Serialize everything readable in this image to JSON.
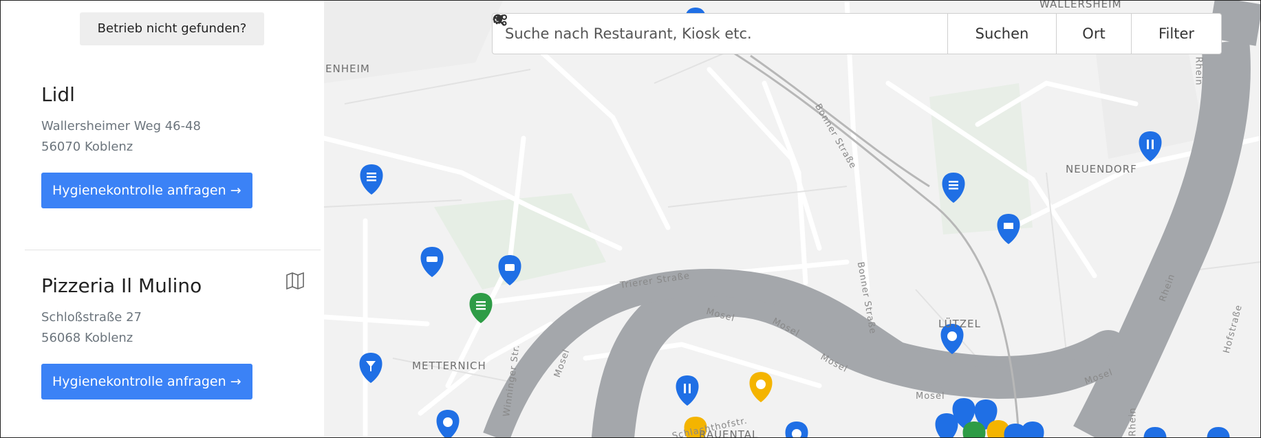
{
  "sidebar": {
    "not_found_label": "Betrieb nicht gefunden?",
    "cards": [
      {
        "name": "Lidl",
        "street": "Wallersheimer Weg 46-48",
        "city": "56070 Koblenz",
        "button": "Hygienekontrolle anfragen →"
      },
      {
        "name": "Pizzeria Il Mulino",
        "street": "Schloßstraße 27",
        "city": "56068 Koblenz",
        "button": "Hygienekontrolle anfragen →"
      }
    ]
  },
  "search": {
    "placeholder": "Suche nach Restaurant, Kiosk etc.",
    "search_label": "Suchen",
    "location_label": "Ort",
    "filter_label": "Filter"
  },
  "map": {
    "labels": [
      "WALLERSHEIM",
      "ENHEIM",
      "NEUENDORF",
      "METTERNICH",
      "LÜTZEL",
      "RAUENTAL",
      "Bonner Straße",
      "Bonner Straße",
      "Trierer Straße",
      "Winninger Str.",
      "Schlachthofstr.",
      "Mosel",
      "Mosel",
      "Mosel",
      "Mosel",
      "Mosel",
      "Mosel",
      "Rhein",
      "Rhein",
      "Rhein",
      "Hofstraße"
    ],
    "colors": {
      "blue_marker": "#1f6fe5",
      "green_marker": "#2e9c46",
      "yellow_marker": "#f4b400",
      "river": "#a4a7ab",
      "button": "#3b82f6"
    }
  }
}
